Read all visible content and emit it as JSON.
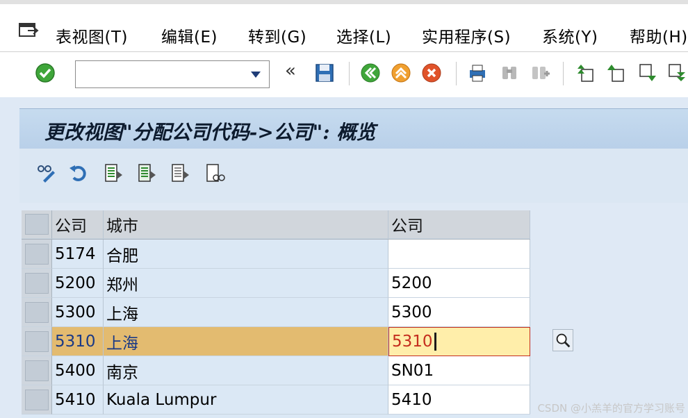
{
  "menu": {
    "items": [
      "表视图(T)",
      "编辑(E)",
      "转到(G)",
      "选择(L)",
      "实用程序(S)",
      "系统(Y)",
      "帮助(H)"
    ]
  },
  "toolbar": {
    "command_field_value": "",
    "icons": [
      "enter-icon",
      "back-icon",
      "save-icon",
      "exit-icon",
      "cancel-icon",
      "print-icon",
      "find-icon",
      "find-next-icon",
      "first-page-icon",
      "previous-page-icon",
      "next-page-icon",
      "last-page-icon"
    ]
  },
  "screen": {
    "title": "更改视图\"分配公司代码->公司\": 概览"
  },
  "table": {
    "headers": [
      "公司",
      "城市",
      "公司"
    ],
    "rows": [
      {
        "company_code": "5174",
        "city": "合肥",
        "company": ""
      },
      {
        "company_code": "5200",
        "city": "郑州",
        "company": "5200"
      },
      {
        "company_code": "5300",
        "city": "上海",
        "company": "5300"
      },
      {
        "company_code": "5310",
        "city": "上海",
        "company": "5310"
      },
      {
        "company_code": "5400",
        "city": "南京",
        "company": "SN01"
      },
      {
        "company_code": "5410",
        "city": "Kuala Lumpur",
        "company": "5410"
      }
    ],
    "selected_row": 3
  },
  "watermark": "CSDN @小羔羊的官方学习账号",
  "colors": {
    "accent": "#1f4e8c",
    "selected_row": "#e3bb70",
    "editing_cell": "#ffeeaa",
    "error_text": "#c42d1e"
  }
}
